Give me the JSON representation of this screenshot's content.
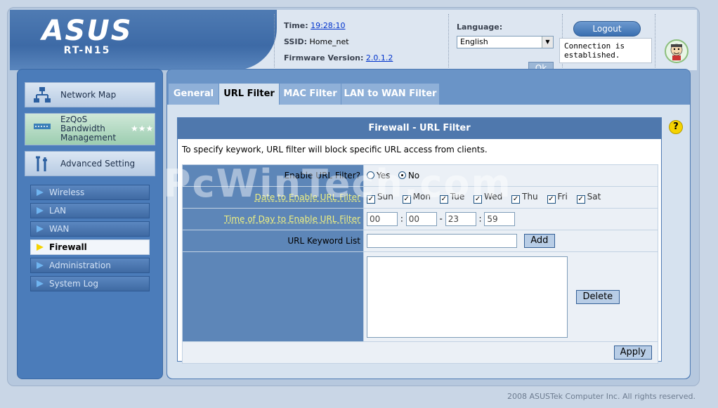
{
  "header": {
    "brand": "ASUS",
    "model": "RT-N15",
    "time_label": "Time:",
    "time_value": "19:28:10",
    "ssid_label": "SSID:",
    "ssid_value": "Home_net",
    "firmware_label": "Firmware Version:",
    "firmware_value": "2.0.1.2",
    "language_label": "Language:",
    "language_value": "English",
    "ok_label": "Ok",
    "logout_label": "Logout",
    "connection_status": "Connection is established."
  },
  "sidebar": {
    "main_items": [
      {
        "label": "Network Map",
        "icon": "network-map-icon"
      },
      {
        "label": "EzQoS Bandwidth Management",
        "icon": "qos-icon"
      },
      {
        "label": "Advanced Setting",
        "icon": "tools-icon"
      }
    ],
    "sub_items": [
      {
        "label": "Wireless",
        "active": false
      },
      {
        "label": "LAN",
        "active": false
      },
      {
        "label": "WAN",
        "active": false
      },
      {
        "label": "Firewall",
        "active": true
      },
      {
        "label": "Administration",
        "active": false
      },
      {
        "label": "System Log",
        "active": false
      }
    ]
  },
  "tabs": [
    {
      "label": "General",
      "active": false
    },
    {
      "label": "URL Filter",
      "active": true
    },
    {
      "label": "MAC Filter",
      "active": false
    },
    {
      "label": "LAN to WAN Filter",
      "active": false
    }
  ],
  "panel": {
    "title": "Firewall - URL Filter",
    "description": "To specify keywork, URL filter will block specific URL access from clients.",
    "enable_label": "Enable URL Filter?",
    "yes_label": "Yes",
    "no_label": "No",
    "enabled": "No",
    "date_label": "Date to Enable URL Filter",
    "days": [
      {
        "label": "Sun",
        "checked": true
      },
      {
        "label": "Mon",
        "checked": true
      },
      {
        "label": "Tue",
        "checked": true
      },
      {
        "label": "Wed",
        "checked": true
      },
      {
        "label": "Thu",
        "checked": true
      },
      {
        "label": "Fri",
        "checked": true
      },
      {
        "label": "Sat",
        "checked": true
      }
    ],
    "time_label": "Time of Day to Enable URL Filter",
    "start_hour": "00",
    "start_min": "00",
    "end_hour": "23",
    "end_min": "59",
    "time_sep": ":",
    "range_sep": "-",
    "keyword_label": "URL Keyword List",
    "keyword_value": "",
    "add_label": "Add",
    "delete_label": "Delete",
    "apply_label": "Apply"
  },
  "footer": "2008 ASUSTek Computer Inc. All rights reserved.",
  "watermark": "PcWinTech.com",
  "colors": {
    "accent": "#4f78ad",
    "sidebar": "#4b7cba",
    "active_marker": "#f5d300"
  }
}
